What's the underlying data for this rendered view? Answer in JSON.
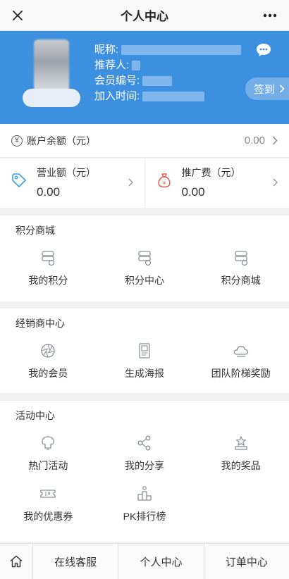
{
  "header": {
    "title": "个人中心"
  },
  "profile": {
    "nickname_label": "昵称:",
    "referrer_label": "推荐人:",
    "member_no_label": "会员编号:",
    "join_time_label": "加入时间:",
    "signin_label": "签到"
  },
  "balance": {
    "label": "账户余额（元）",
    "value": "0.00"
  },
  "stats": [
    {
      "label": "营业额（元）",
      "value": "0.00"
    },
    {
      "label": "推广费（元）",
      "value": "0.00"
    }
  ],
  "sections": {
    "points": {
      "title": "积分商城",
      "items": [
        "我的积分",
        "积分中心",
        "积分商城"
      ]
    },
    "dealer": {
      "title": "经销商中心",
      "items": [
        "我的会员",
        "生成海报",
        "团队阶梯奖励"
      ]
    },
    "activity": {
      "title": "活动中心",
      "items": [
        "热门活动",
        "我的分享",
        "我的奖品",
        "我的优惠券",
        "PK排行榜"
      ]
    }
  },
  "tabbar": {
    "items": [
      "在线客服",
      "个人中心",
      "订单中心"
    ]
  },
  "colors": {
    "brand_blue": "#3d8fe0",
    "icon_gray": "#8a8f96",
    "stat_blue": "#3aa0e8",
    "stat_red": "#e85a4f"
  },
  "icons": {
    "header": [
      "close-icon",
      "more-icon"
    ],
    "profile": [
      "chat-bubble-icon",
      "chevron-right-icon"
    ],
    "balance": "yen-icon",
    "stats": [
      "price-tag-icon",
      "money-bag-icon"
    ],
    "points": [
      "coupon-stack-icon",
      "coupon-stack-icon",
      "coupon-stack-icon"
    ],
    "dealer": [
      "aperture-icon",
      "poster-icon",
      "cloud-icon"
    ],
    "activity": [
      "cake-icon",
      "share-icon",
      "award-icon",
      "ticket-icon",
      "podium-icon"
    ],
    "tabbar": "home-icon"
  }
}
